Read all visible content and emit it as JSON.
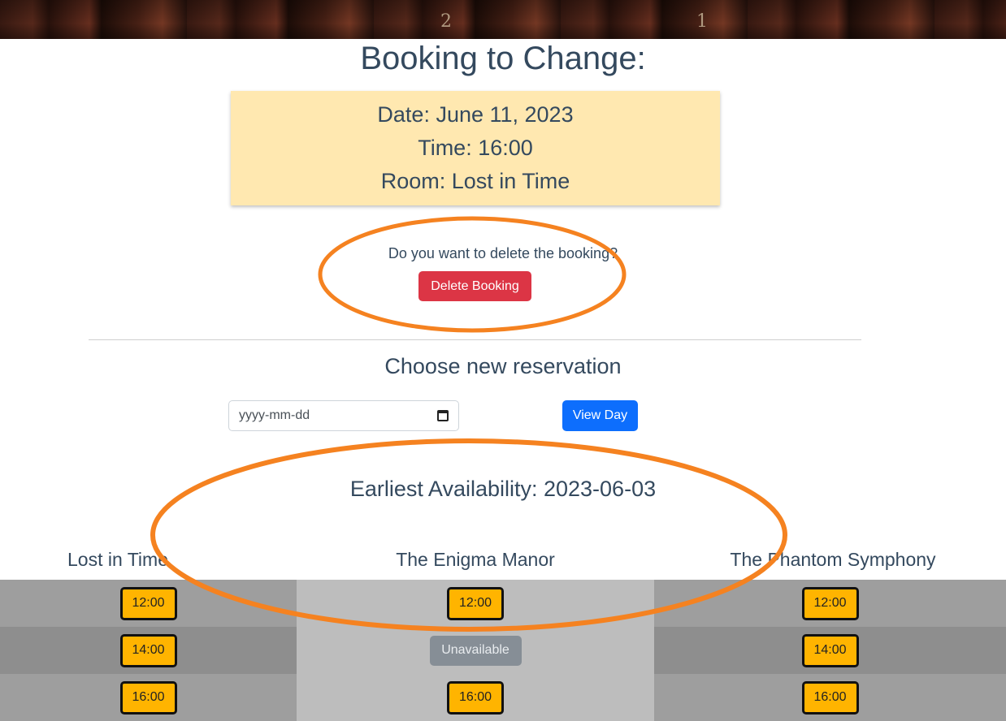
{
  "page": {
    "title": "Booking to Change:"
  },
  "booking": {
    "date": "Date: June 11, 2023",
    "time": "Time: 16:00",
    "room": "Room: Lost in Time"
  },
  "delete_section": {
    "question": "Do you want to delete the booking?",
    "button_label": "Delete Booking"
  },
  "reservation": {
    "title": "Choose new reservation",
    "date_placeholder": "yyyy-mm-dd",
    "view_button_label": "View Day",
    "earliest": "Earliest Availability: 2023-06-03"
  },
  "rooms": [
    {
      "name": "Lost in Time",
      "slots": [
        "12:00",
        "14:00",
        "16:00"
      ]
    },
    {
      "name": "The Enigma Manor",
      "slots": [
        "12:00",
        "Unavailable",
        "16:00"
      ]
    },
    {
      "name": "The Phantom Symphony",
      "slots": [
        "12:00",
        "14:00",
        "16:00"
      ]
    }
  ],
  "banner": {
    "book_numbers": [
      "2",
      "1"
    ]
  },
  "colors": {
    "heading": "#34495e",
    "card_bg": "#ffe8b0",
    "delete_button": "#dc3545",
    "view_button": "#0d6efd",
    "slot_button": "#ffb400",
    "unavailable": "#868e96",
    "annotation": "#f58220"
  }
}
